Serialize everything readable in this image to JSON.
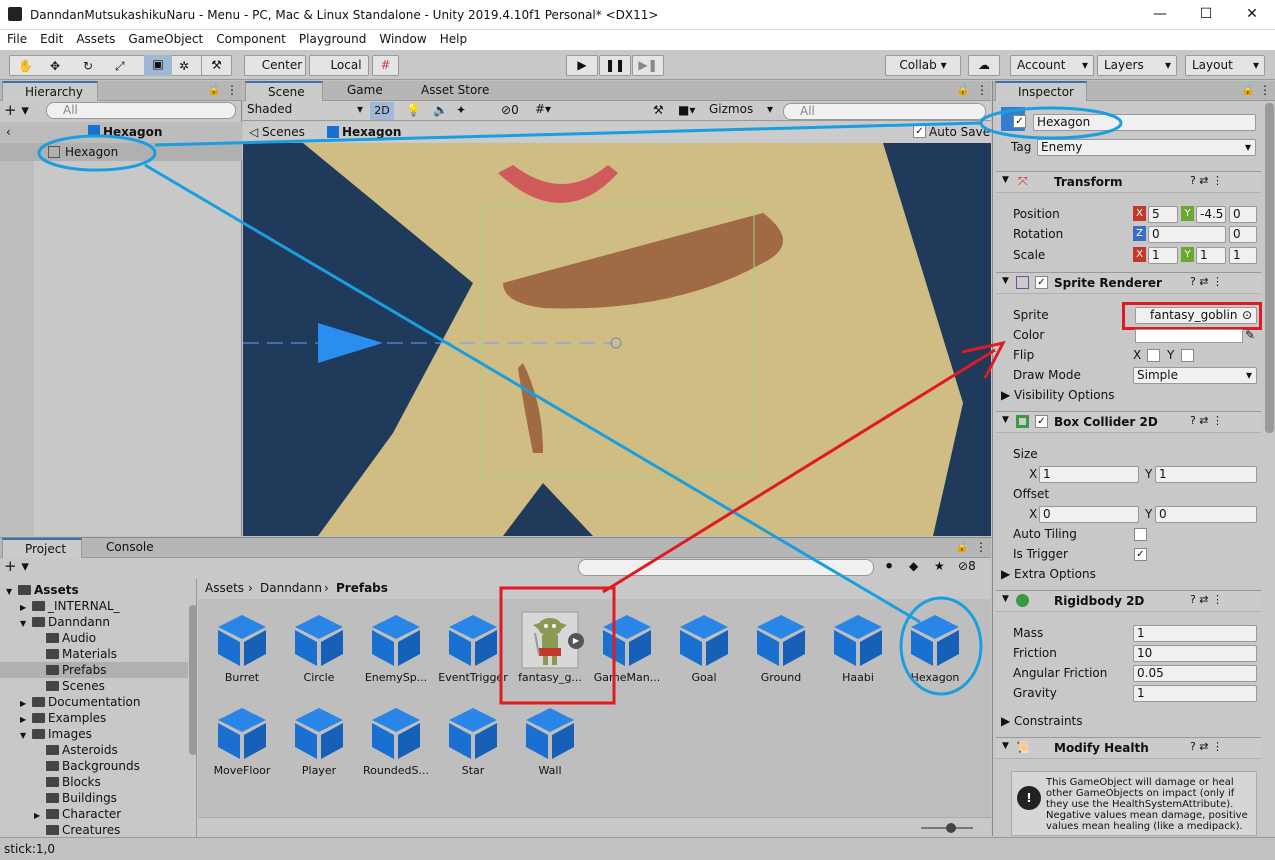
{
  "window": {
    "title": "DanndanMutsukashikuNaru - Menu - PC, Mac & Linux Standalone - Unity 2019.4.10f1 Personal* <DX11>",
    "min": "—",
    "max": "☐",
    "close": "✕"
  },
  "menu": [
    "File",
    "Edit",
    "Assets",
    "GameObject",
    "Component",
    "Playground",
    "Window",
    "Help"
  ],
  "toolbar": {
    "center": "Center",
    "local": "Local",
    "collab": "Collab ▾",
    "account": "Account",
    "layers": "Layers",
    "layout": "Layout"
  },
  "hierarchy": {
    "tab": "Hierarchy",
    "search": "All",
    "scene": "Hexagon",
    "item": "Hexagon"
  },
  "scene": {
    "tabs": [
      "Scene",
      "Game",
      "Asset Store"
    ],
    "shading": "Shaded",
    "mode2d": "2D",
    "hidden_count": "0",
    "gizmos": "Gizmos",
    "search": "All",
    "breadcrumb_scenes": "Scenes",
    "breadcrumb_prefab": "Hexagon",
    "autosave": "Auto Save"
  },
  "inspector": {
    "tab": "Inspector",
    "name": "Hexagon",
    "tag_label": "Tag",
    "tag": "Enemy",
    "transform": {
      "title": "Transform",
      "position_label": "Position",
      "rotation_label": "Rotation",
      "scale_label": "Scale",
      "pos": [
        "5",
        "-4.5",
        "0"
      ],
      "rot": [
        "0",
        "0"
      ],
      "scale": [
        "1",
        "1",
        "1"
      ]
    },
    "sprite_renderer": {
      "title": "Sprite Renderer",
      "sprite_label": "Sprite",
      "sprite": "fantasy_goblin",
      "color_label": "Color",
      "flip_label": "Flip",
      "flip_x": "X",
      "flip_y": "Y",
      "drawmode_label": "Draw Mode",
      "drawmode": "Simple",
      "visibility": "Visibility Options"
    },
    "box_collider": {
      "title": "Box Collider 2D",
      "size_label": "Size",
      "size": [
        "1",
        "1"
      ],
      "offset_label": "Offset",
      "offset": [
        "0",
        "0"
      ],
      "autotiling": "Auto Tiling",
      "istrigger": "Is Trigger",
      "extra": "Extra Options"
    },
    "rigidbody": {
      "title": "Rigidbody 2D",
      "mass_label": "Mass",
      "mass": "1",
      "friction_label": "Friction",
      "friction": "10",
      "angular_label": "Angular Friction",
      "angular": "0.05",
      "gravity_label": "Gravity",
      "gravity": "1",
      "constraints": "Constraints"
    },
    "modify_health": {
      "title": "Modify Health",
      "help": "This GameObject will damage or heal other GameObjects on impact (only if they use the HealthSystemAttribute). Negative values mean damage, positive values mean healing (like a medipack)."
    }
  },
  "project": {
    "tabs": [
      "Project",
      "Console"
    ],
    "hidden_count": "8",
    "breadcrumb": [
      "Assets",
      "Danndann",
      "Prefabs"
    ],
    "tree": [
      {
        "label": "Assets",
        "depth": 0,
        "bold": true,
        "arrow": "▼"
      },
      {
        "label": "_INTERNAL_",
        "depth": 1,
        "arrow": "▶"
      },
      {
        "label": "Danndann",
        "depth": 1,
        "arrow": "▼"
      },
      {
        "label": "Audio",
        "depth": 2,
        "arrow": ""
      },
      {
        "label": "Materials",
        "depth": 2,
        "arrow": ""
      },
      {
        "label": "Prefabs",
        "depth": 2,
        "arrow": "",
        "selected": true
      },
      {
        "label": "Scenes",
        "depth": 2,
        "arrow": ""
      },
      {
        "label": "Documentation",
        "depth": 1,
        "arrow": "▶"
      },
      {
        "label": "Examples",
        "depth": 1,
        "arrow": "▶"
      },
      {
        "label": "Images",
        "depth": 1,
        "arrow": "▼"
      },
      {
        "label": "Asteroids",
        "depth": 2,
        "arrow": ""
      },
      {
        "label": "Backgrounds",
        "depth": 2,
        "arrow": ""
      },
      {
        "label": "Blocks",
        "depth": 2,
        "arrow": ""
      },
      {
        "label": "Buildings",
        "depth": 2,
        "arrow": ""
      },
      {
        "label": "Character",
        "depth": 2,
        "arrow": "▶"
      },
      {
        "label": "Creatures",
        "depth": 2,
        "arrow": ""
      }
    ],
    "assets_row1": [
      "Burret",
      "Circle",
      "EnemySp...",
      "EventTrigger",
      "fantasy_g...",
      "GameMan...",
      "Goal",
      "Ground",
      "Haabi",
      "Hexagon"
    ],
    "assets_row2": [
      "MoveFloor",
      "Player",
      "RoundedS...",
      "Star",
      "Wall"
    ]
  },
  "status": "stick:1,0",
  "colors": {
    "annotation_blue": "#1a9ee0",
    "annotation_red": "#e01a22",
    "scene_dark": "#1f3a5a",
    "scene_sand": "#cfbd83",
    "cube_blue": "#1a70d0"
  }
}
